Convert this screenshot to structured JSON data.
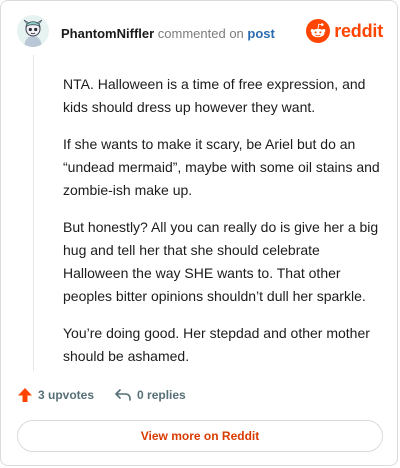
{
  "comment": {
    "username": "PhantomNiffler",
    "action_text": "commented on",
    "post_link": "post",
    "paragraphs": [
      "NTA. Halloween is a time of free expression, and kids should dress up however they want.",
      "If she wants to make it scary, be Ariel but do an “undead mermaid”, maybe with some oil stains and zombie-ish make up.",
      "But honestly? All you can really do is give her a big hug and tell her that she should celebrate Halloween the way SHE wants to. That other peoples bitter opinions shouldn’t dull her sparkle.",
      "You’re doing good. Her stepdad and other mother should be ashamed."
    ],
    "upvotes": "3 upvotes",
    "replies": "0 replies"
  },
  "brand": {
    "name": "reddit",
    "icon": "reddit-snoo-icon",
    "color": "#ff4500"
  },
  "footer": {
    "view_more": "View more on Reddit"
  },
  "icons": {
    "avatar": "avatar-icon",
    "upvote": "upvote-arrow-icon",
    "reply": "reply-arrow-icon"
  },
  "colors": {
    "upvote": "#ff4500",
    "link": "#2b6cb0",
    "view_more": "#d93a00"
  }
}
